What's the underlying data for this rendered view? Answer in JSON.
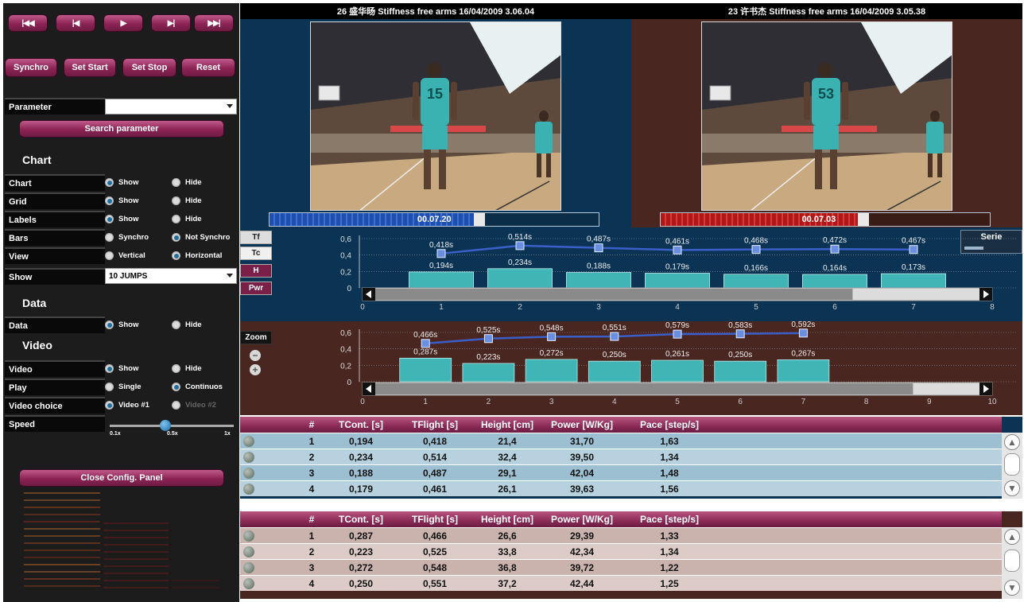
{
  "transport": {
    "first": "|◀◀",
    "prev": "|◀",
    "play": "▶",
    "next": "▶|",
    "last": "▶▶|"
  },
  "controls": {
    "synchro": "Synchro",
    "set_start": "Set Start",
    "set_stop": "Set Stop",
    "reset": "Reset"
  },
  "parameter": {
    "label": "Parameter",
    "value": "",
    "search_button": "Search parameter"
  },
  "chart_section": {
    "title": "Chart",
    "rows": [
      {
        "label": "Chart",
        "opt1": "Show",
        "opt2": "Hide",
        "selected": 1
      },
      {
        "label": "Grid",
        "opt1": "Show",
        "opt2": "Hide",
        "selected": 1
      },
      {
        "label": "Labels",
        "opt1": "Show",
        "opt2": "Hide",
        "selected": 1
      },
      {
        "label": "Bars",
        "opt1": "Synchro",
        "opt2": "Not Synchro",
        "selected": 2
      },
      {
        "label": "View",
        "opt1": "Vertical",
        "opt2": "Horizontal",
        "selected": 2
      }
    ],
    "show_label": "Show",
    "show_value": "10 JUMPS"
  },
  "data_section": {
    "title": "Data",
    "label": "Data",
    "opt1": "Show",
    "opt2": "Hide"
  },
  "video_section": {
    "title": "Video",
    "rows": [
      {
        "label": "Video",
        "opt1": "Show",
        "opt2": "Hide",
        "selected": 1
      },
      {
        "label": "Play",
        "opt1": "Single",
        "opt2": "Continuos",
        "selected": 2
      },
      {
        "label": "Video choice",
        "opt1": "Video #1",
        "opt2": "Video #2",
        "selected": 1
      }
    ],
    "speed_label": "Speed",
    "speed_ticks": [
      "0.1x",
      "0.5x",
      "1x"
    ],
    "speed_value": 0.5
  },
  "close_panel": "Close Config. Panel",
  "video_left": {
    "title": "26 盛华旸 Stiffness free arms 16/04/2009 3.06.04",
    "time": "00.07.20",
    "progress": 0.62,
    "bib": "15"
  },
  "video_right": {
    "title": "23 许书杰 Stiffness free arms 16/04/2009 3.05.38",
    "time": "00.07.03",
    "progress": 0.6,
    "bib": "53"
  },
  "chart_buttons": [
    "Tf",
    "Tc",
    "H",
    "Pwr"
  ],
  "zoom_label": "Zoom",
  "legend_title": "Serie",
  "chart_data": [
    {
      "type": "bar",
      "x": [
        1,
        2,
        3,
        4,
        5,
        6,
        7
      ],
      "series": [
        {
          "name": "TFlight",
          "kind": "line",
          "values": [
            0.418,
            0.514,
            0.487,
            0.461,
            0.468,
            0.472,
            0.467
          ],
          "labels": [
            "0,418s",
            "0,514s",
            "0,487s",
            "0,461s",
            "0,468s",
            "0,472s",
            "0,467s"
          ]
        },
        {
          "name": "TCont",
          "kind": "bar",
          "values": [
            0.194,
            0.234,
            0.188,
            0.179,
            0.166,
            0.164,
            0.173
          ],
          "labels": [
            "0,194s",
            "0,234s",
            "0,188s",
            "0,179s",
            "0,166s",
            "0,164s",
            "0,173s"
          ]
        }
      ],
      "yticks": [
        "0,6",
        "0,4",
        "0,2",
        "0"
      ],
      "ylim": [
        0,
        0.6
      ],
      "xticks": [
        "0",
        "1",
        "2",
        "3",
        "4",
        "5",
        "6",
        "7",
        "8"
      ],
      "xlim": [
        0,
        8
      ],
      "scroll_visible_fraction": 0.79
    },
    {
      "type": "bar",
      "x": [
        1,
        2,
        3,
        4,
        5,
        6,
        7
      ],
      "series": [
        {
          "name": "TFlight",
          "kind": "line",
          "values": [
            0.466,
            0.525,
            0.548,
            0.551,
            0.579,
            0.583,
            0.592
          ],
          "labels": [
            "0,466s",
            "0,525s",
            "0,548s",
            "0,551s",
            "0,579s",
            "0,583s",
            "0,592s"
          ]
        },
        {
          "name": "TCont",
          "kind": "bar",
          "values": [
            0.287,
            0.223,
            0.272,
            0.25,
            0.261,
            0.25,
            0.267
          ],
          "labels": [
            "0,287s",
            "0,223s",
            "0,272s",
            "0,250s",
            "0,261s",
            "0,250s",
            "0,267s"
          ]
        }
      ],
      "yticks": [
        "0,6",
        "0,4",
        "0,2",
        "0"
      ],
      "ylim": [
        0,
        0.6
      ],
      "xticks": [
        "0",
        "1",
        "2",
        "3",
        "4",
        "5",
        "6",
        "7",
        "8",
        "9",
        "10"
      ],
      "xlim": [
        0,
        10
      ],
      "scroll_visible_fraction": 0.89
    }
  ],
  "table_headers": [
    "#",
    "TCont. [s]",
    "TFlight [s]",
    "Height [cm]",
    "Power [W/Kg]",
    "Pace [step/s]"
  ],
  "table_top": [
    [
      "1",
      "0,194",
      "0,418",
      "21,4",
      "31,70",
      "1,63"
    ],
    [
      "2",
      "0,234",
      "0,514",
      "32,4",
      "39,50",
      "1,34"
    ],
    [
      "3",
      "0,188",
      "0,487",
      "29,1",
      "42,04",
      "1,48"
    ],
    [
      "4",
      "0,179",
      "0,461",
      "26,1",
      "39,63",
      "1,56"
    ]
  ],
  "table_bottom": [
    [
      "1",
      "0,287",
      "0,466",
      "26,6",
      "29,39",
      "1,33"
    ],
    [
      "2",
      "0,223",
      "0,525",
      "33,8",
      "42,34",
      "1,34"
    ],
    [
      "3",
      "0,272",
      "0,548",
      "36,8",
      "39,72",
      "1,22"
    ],
    [
      "4",
      "0,250",
      "0,551",
      "37,2",
      "42,44",
      "1,25"
    ]
  ],
  "colors": {
    "top_bg": "#0b3454",
    "bottom_bg": "#4a2620",
    "accent": "#8c2455",
    "line": "#3a5fc8",
    "bar": "#3fb5b5",
    "row_top_a": "#9cbfd1",
    "row_top_b": "#b7d2de",
    "row_bot_a": "#c9b3ac",
    "row_bot_b": "#dccbc6"
  }
}
